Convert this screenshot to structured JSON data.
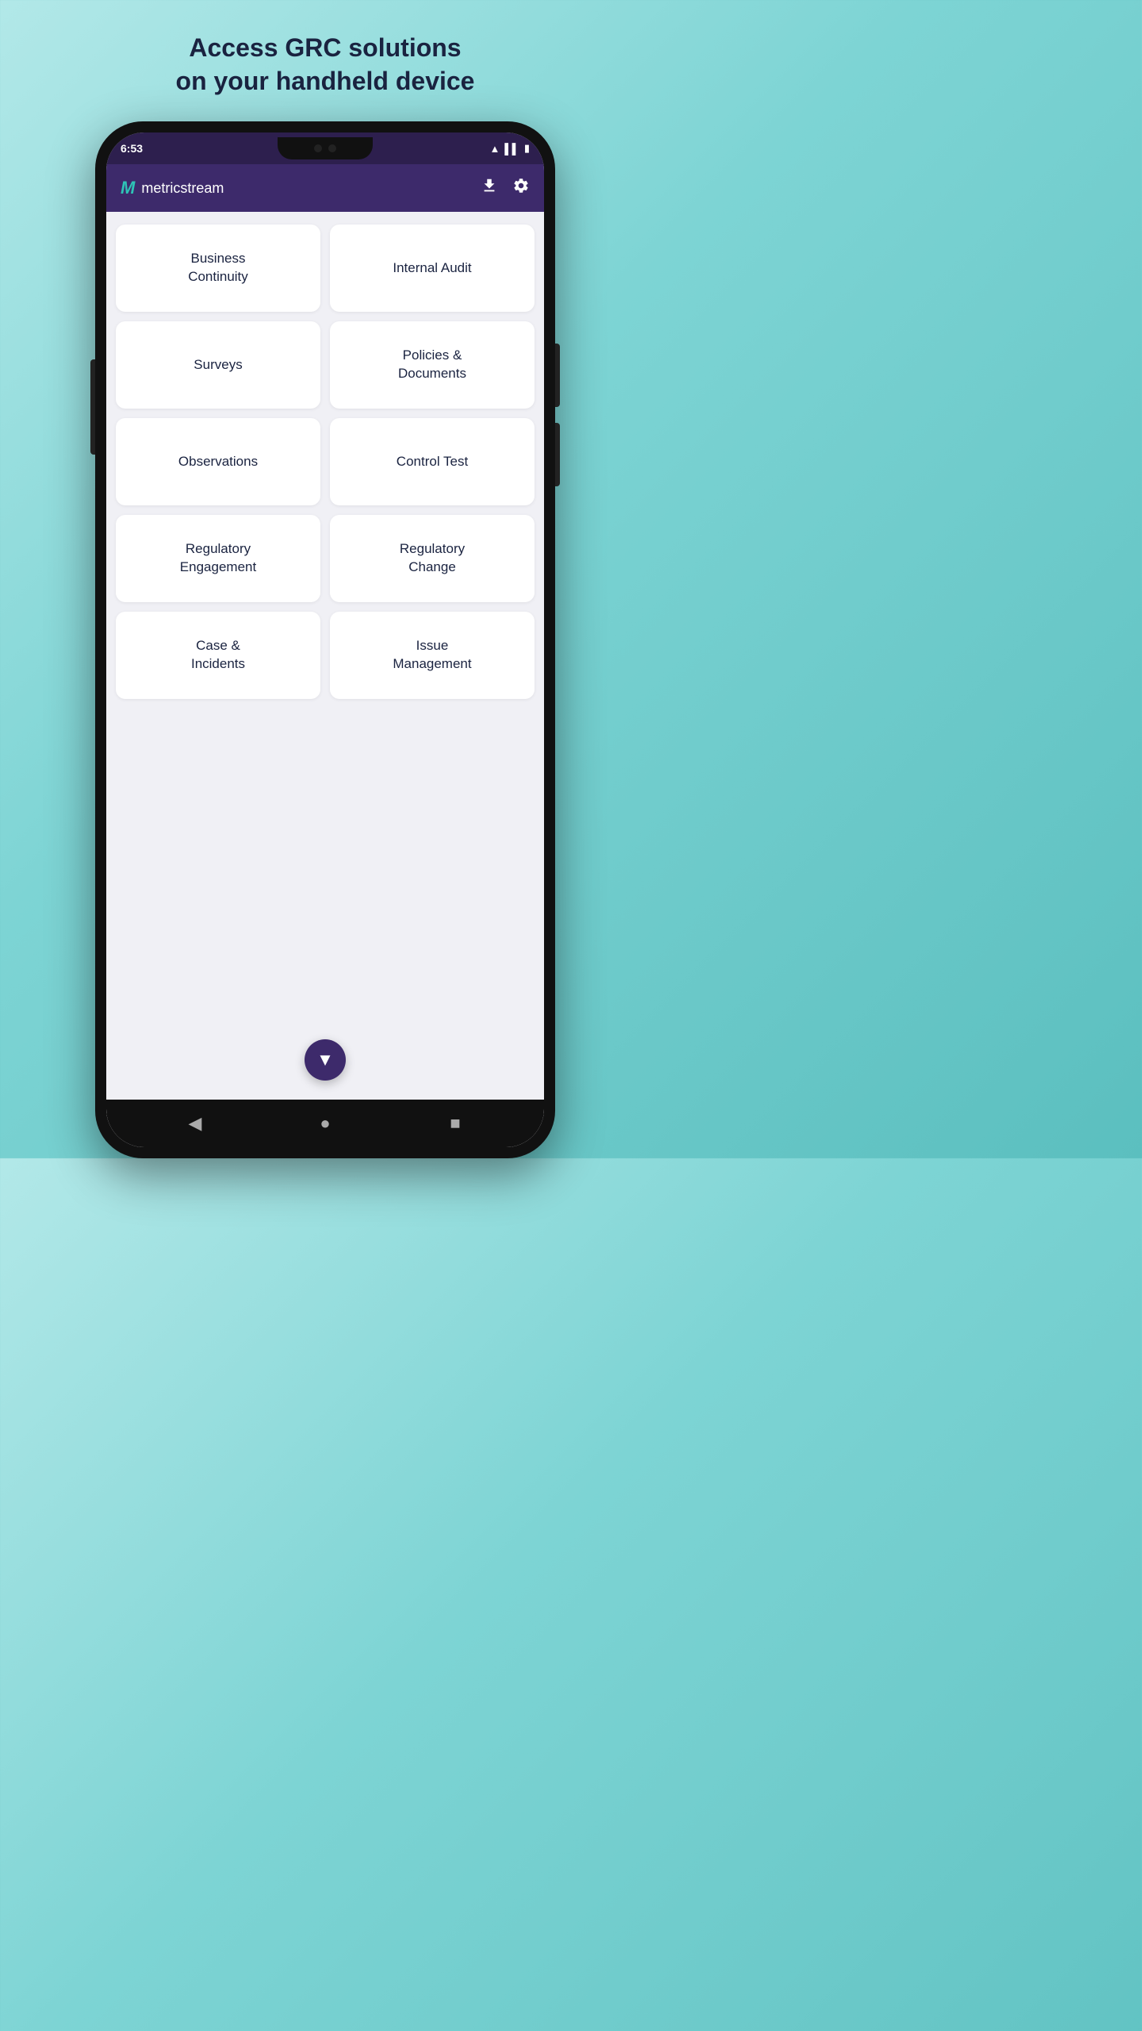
{
  "page": {
    "title_line1": "Access GRC solutions",
    "title_line2": "on your handheld device"
  },
  "status_bar": {
    "time": "6:53",
    "icons": [
      "wifi",
      "signal",
      "battery"
    ]
  },
  "header": {
    "logo_m": "M",
    "logo_text": "metricstream",
    "upload_icon": "⬆",
    "settings_icon": "⚙"
  },
  "tiles": [
    {
      "id": "business-continuity",
      "label": "Business\nContinuity"
    },
    {
      "id": "internal-audit",
      "label": "Internal Audit"
    },
    {
      "id": "surveys",
      "label": "Surveys"
    },
    {
      "id": "policies-documents",
      "label": "Policies &\nDocuments"
    },
    {
      "id": "observations",
      "label": "Observations"
    },
    {
      "id": "control-test",
      "label": "Control Test"
    },
    {
      "id": "regulatory-engagement",
      "label": "Regulatory\nEngagement"
    },
    {
      "id": "regulatory-change",
      "label": "Regulatory\nChange"
    },
    {
      "id": "case-incidents",
      "label": "Case &\nIncidents"
    },
    {
      "id": "issue-management",
      "label": "Issue\nManagement"
    }
  ],
  "fab": {
    "icon": "▼"
  },
  "bottom_nav": {
    "back_icon": "◀",
    "home_icon": "●",
    "square_icon": "■"
  }
}
